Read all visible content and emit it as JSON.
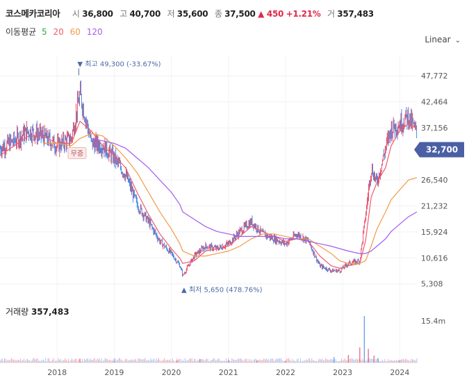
{
  "header": {
    "name": "코스메카코리아",
    "open_label": "시",
    "open": "36,800",
    "high_label": "고",
    "high": "40,700",
    "low_label": "저",
    "low": "35,600",
    "close_label": "종",
    "close": "37,500",
    "change": "▲ 450",
    "change_pct": "+1.21%",
    "volume_label": "거",
    "volume": "357,483"
  },
  "ma": {
    "title": "이동평균",
    "periods": [
      "5",
      "20",
      "60",
      "120"
    ],
    "colors": [
      "#2ca84a",
      "#ef5b6b",
      "#f19a45",
      "#a05cf0"
    ]
  },
  "scale_mode": "Linear",
  "chevron_icon": "chevron-down-icon",
  "current_price_label": "32,700",
  "annotations": {
    "high": "▼ 최고 49,300 (-33.67%)",
    "low": "▲ 최저 5,650 (478.76%)",
    "marker": "무증"
  },
  "volume_panel": {
    "title": "거래량",
    "value": "357,483",
    "axis_label": "15.4m"
  },
  "colors": {
    "up": "#e0294a",
    "down": "#1d6fe0",
    "price_tag": "#4a5fa5"
  },
  "chart_data": {
    "type": "line",
    "y_ticks": [
      "47,772",
      "42,464",
      "37,156",
      "32,700",
      "26,540",
      "21,232",
      "15,924",
      "10,616",
      "5,308"
    ],
    "x_ticks": [
      "2018",
      "2019",
      "2020",
      "2021",
      "2022",
      "2023",
      "2024"
    ],
    "ylim": [
      3000,
      50500
    ],
    "x": [
      2017.0,
      2017.25,
      2017.5,
      2017.75,
      2018.0,
      2018.25,
      2018.4,
      2018.6,
      2018.8,
      2019.0,
      2019.2,
      2019.4,
      2019.6,
      2019.8,
      2020.0,
      2020.15,
      2020.2,
      2020.4,
      2020.6,
      2020.8,
      2021.0,
      2021.2,
      2021.4,
      2021.6,
      2021.8,
      2022.0,
      2022.2,
      2022.4,
      2022.6,
      2022.8,
      2022.95,
      2023.1,
      2023.3,
      2023.4,
      2023.5,
      2023.6,
      2023.75,
      2023.85,
      2024.0,
      2024.15,
      2024.3
    ],
    "close": [
      33000,
      34500,
      36500,
      35500,
      33500,
      35000,
      44000,
      34000,
      33500,
      31000,
      27500,
      21500,
      18000,
      14000,
      11500,
      9000,
      7000,
      11000,
      13000,
      12500,
      13500,
      16000,
      18000,
      15500,
      14500,
      13500,
      15500,
      14000,
      9000,
      8000,
      8000,
      9500,
      10000,
      19000,
      29000,
      26000,
      33000,
      37000,
      38000,
      39500,
      36000
    ],
    "ma_values": {
      "20": [
        31500,
        33500,
        35500,
        35500,
        34000,
        34000,
        38500,
        36500,
        33500,
        31500,
        29000,
        24000,
        19500,
        15500,
        12500,
        10500,
        9500,
        10000,
        12000,
        12500,
        13000,
        15000,
        17000,
        16000,
        15000,
        14000,
        14500,
        14000,
        11000,
        9000,
        8500,
        9000,
        9500,
        14000,
        23000,
        26000,
        29000,
        33500,
        36500,
        38000,
        37000
      ],
      "60": [
        null,
        null,
        null,
        34000,
        34000,
        33500,
        35000,
        36000,
        35500,
        33500,
        31000,
        28000,
        24000,
        20000,
        16500,
        13500,
        12000,
        11000,
        11000,
        11500,
        12000,
        13000,
        14500,
        15500,
        15500,
        15000,
        14500,
        14500,
        13000,
        11500,
        10000,
        9500,
        9500,
        10000,
        13000,
        16500,
        20000,
        22500,
        24500,
        26500,
        27000
      ],
      "120": [
        null,
        null,
        null,
        null,
        null,
        null,
        null,
        35000,
        34500,
        34000,
        33000,
        31000,
        29000,
        26500,
        24000,
        21500,
        20000,
        18500,
        17000,
        16000,
        15500,
        15000,
        15000,
        15000,
        15000,
        14500,
        14500,
        14000,
        13500,
        13000,
        12500,
        12000,
        11500,
        11500,
        12000,
        13000,
        14500,
        16000,
        17500,
        19000,
        20000
      ]
    },
    "volume_ylim": [
      0,
      15400000
    ],
    "volume_x": [
      2018.4,
      2019.0,
      2020.1,
      2020.5,
      2021.0,
      2021.5,
      2022.0,
      2022.85,
      2023.1,
      2023.3,
      2023.38,
      2023.45,
      2023.55,
      2023.62,
      2024.0
    ],
    "volume": [
      1300000,
      500000,
      700000,
      1200000,
      800000,
      700000,
      500000,
      1800000,
      2500000,
      5000000,
      15400000,
      4500000,
      2300000,
      1500000,
      700000
    ]
  }
}
